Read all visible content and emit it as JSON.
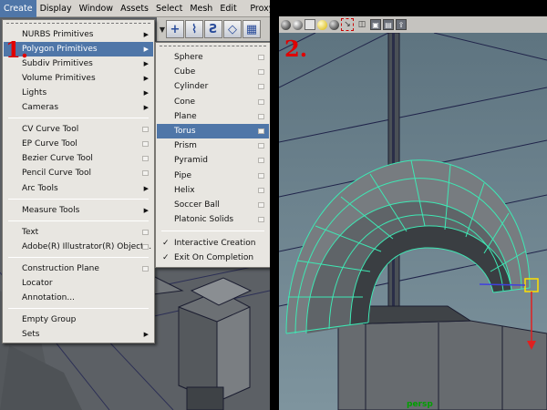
{
  "menubar": {
    "items": [
      "Create",
      "Display",
      "Window",
      "Assets",
      "Select",
      "Mesh",
      "Edit Mesh",
      "Proxy"
    ],
    "active_index": 0
  },
  "create_menu": {
    "items": [
      {
        "label": "NURBS Primitives",
        "kind": "submenu"
      },
      {
        "label": "Polygon Primitives",
        "kind": "submenu",
        "highlighted": true
      },
      {
        "label": "Subdiv Primitives",
        "kind": "submenu"
      },
      {
        "label": "Volume Primitives",
        "kind": "submenu"
      },
      {
        "label": "Lights",
        "kind": "submenu"
      },
      {
        "label": "Cameras",
        "kind": "submenu"
      },
      {
        "label": "CV Curve Tool",
        "kind": "option"
      },
      {
        "label": "EP Curve Tool",
        "kind": "option"
      },
      {
        "label": "Bezier Curve Tool",
        "kind": "option"
      },
      {
        "label": "Pencil Curve Tool",
        "kind": "option"
      },
      {
        "label": "Arc Tools",
        "kind": "submenu"
      },
      {
        "label": "Measure Tools",
        "kind": "submenu"
      },
      {
        "label": "Text",
        "kind": "option"
      },
      {
        "label": "Adobe(R) Illustrator(R) Object...",
        "kind": "option"
      },
      {
        "label": "Construction Plane",
        "kind": "option"
      },
      {
        "label": "Locator",
        "kind": "plain"
      },
      {
        "label": "Annotation...",
        "kind": "plain"
      },
      {
        "label": "Empty Group",
        "kind": "plain"
      },
      {
        "label": "Sets",
        "kind": "submenu"
      }
    ]
  },
  "polygon_submenu": {
    "items": [
      {
        "label": "Sphere"
      },
      {
        "label": "Cube"
      },
      {
        "label": "Cylinder"
      },
      {
        "label": "Cone"
      },
      {
        "label": "Plane"
      },
      {
        "label": "Torus",
        "highlighted": true
      },
      {
        "label": "Prism"
      },
      {
        "label": "Pyramid"
      },
      {
        "label": "Pipe"
      },
      {
        "label": "Helix"
      },
      {
        "label": "Soccer Ball"
      },
      {
        "label": "Platonic Solids"
      },
      {
        "label": "Interactive Creation",
        "checked": true
      },
      {
        "label": "Exit On Completion",
        "checked": true
      }
    ]
  },
  "toolbar": {
    "icons": [
      "plus-snap-icon",
      "curve-snap-icon",
      "s-curve-icon",
      "plane-grid-icon",
      "grid-box-icon"
    ]
  },
  "steps": {
    "step1": "1.",
    "step2": "2."
  },
  "viewport": {
    "camera_label": "persp"
  },
  "colors": {
    "highlight": "#4f76a8",
    "menu_bg": "#e8e6e1",
    "step_label": "#e00000",
    "wireframe": "#3ee8b4",
    "camera_label": "#00a000"
  }
}
